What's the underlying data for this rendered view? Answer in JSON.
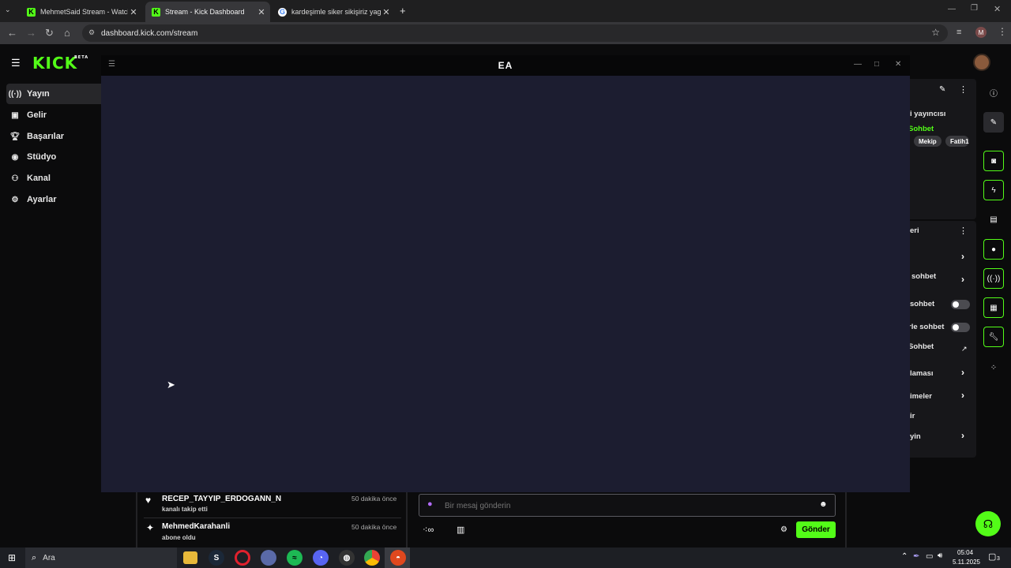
{
  "browser": {
    "tabs": [
      {
        "title": "MehmetSaid Stream - Watch Li",
        "favicon": "kick"
      },
      {
        "title": "Stream - Kick Dashboard",
        "favicon": "kick"
      },
      {
        "title": "kardeşimle siker sikişiriz yagız ş",
        "favicon": "google"
      }
    ],
    "url": "dashboard.kick.com/stream",
    "profile_initial": "M"
  },
  "sidebar": {
    "logo": "KICK",
    "logo_badge": "BETA",
    "items": [
      {
        "label": "Yayın",
        "icon": "broadcast-icon"
      },
      {
        "label": "Gelir",
        "icon": "wallet-icon"
      },
      {
        "label": "Başarılar",
        "icon": "trophy-icon"
      },
      {
        "label": "Stüdyo",
        "icon": "camera-icon"
      },
      {
        "label": "Kanal",
        "icon": "people-icon"
      },
      {
        "label": "Ayarlar",
        "icon": "gear-icon"
      }
    ]
  },
  "overlay_window": {
    "title": "EA"
  },
  "right_panel": {
    "streamer_text": "i yayıncısı",
    "chat_link": "Sohbet",
    "pills": [
      "Mekip",
      "Fatih1"
    ],
    "section_title": "eri",
    "rows": [
      {
        "label": "",
        "control": "chevron"
      },
      {
        "label": "sohbet",
        "control": "chevron"
      },
      {
        "label": "sohbet",
        "control": "toggle"
      },
      {
        "label": "rle sohbet",
        "control": "toggle"
      },
      {
        "label": "Sohbet",
        "control": "external"
      },
      {
        "label": "laması",
        "control": "chevron"
      },
      {
        "label": "imeler",
        "control": "chevron"
      },
      {
        "label": "ir",
        "control": "none"
      },
      {
        "label": "yin",
        "control": "chevron"
      }
    ]
  },
  "activity": [
    {
      "name": "RECEP_TAYYIP_ERDOGANN_N",
      "action": "kanalı takip etti",
      "time": "50 dakika önce",
      "icon": "heart-icon"
    },
    {
      "name": "MehmedKarahanli",
      "action": "abone oldu",
      "time": "50 dakika önce",
      "icon": "sparkle-icon"
    }
  ],
  "chat": {
    "placeholder": "Bir mesaj gönderin",
    "send_label": "Gönder"
  },
  "taskbar": {
    "search_placeholder": "Ara",
    "time": "05:04",
    "date": "5.11.2025",
    "notification_count": "3"
  },
  "colors": {
    "kick_green": "#53fc18",
    "overlay_bg": "#1c1d30",
    "page_bg": "#0b0b0c"
  }
}
